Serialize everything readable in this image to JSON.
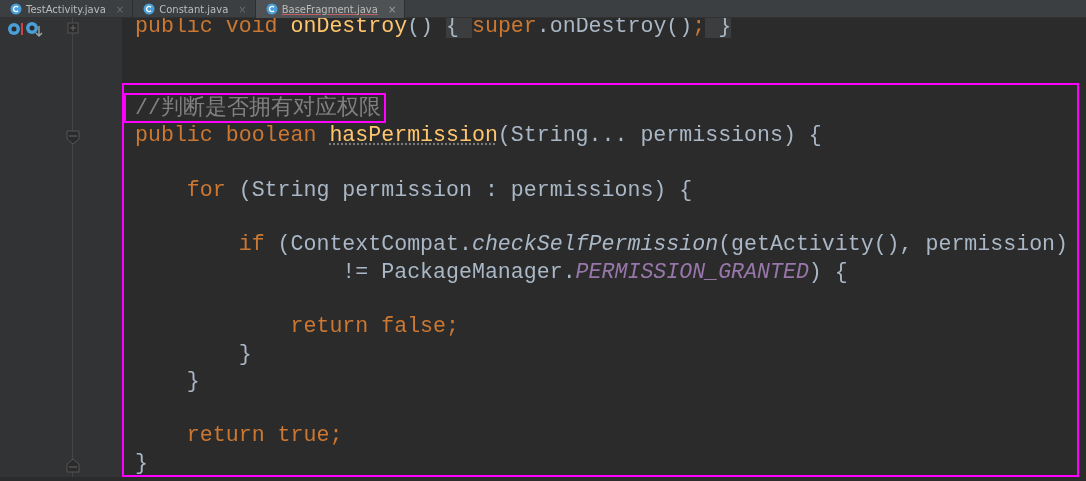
{
  "tabs": [
    {
      "label": "TestActivity.java",
      "selected": false,
      "close": "×"
    },
    {
      "label": "Constant.java",
      "selected": false,
      "close": "×"
    },
    {
      "label": "BaseFragment.java",
      "selected": true,
      "close": "×"
    }
  ],
  "code": {
    "lines": [
      {
        "kind": "code",
        "gutter_marks": true,
        "folded": true,
        "segments": [
          {
            "kind": "keyword",
            "text": "public void "
          },
          {
            "kind": "declaration",
            "text": "onDestroy"
          },
          {
            "kind": "plain",
            "text": "() "
          },
          {
            "kind": "fold",
            "text": "{ "
          },
          {
            "kind": "keyword",
            "text": "super"
          },
          {
            "kind": "plain",
            "text": ".onDestroy()"
          },
          {
            "kind": "keyword",
            "text": ";"
          },
          {
            "kind": "fold",
            "text": " }"
          }
        ]
      },
      {
        "kind": "blank"
      },
      {
        "kind": "blank"
      }
    ],
    "framed_lines": [
      {
        "kind": "code",
        "segments": [
          {
            "kind": "comment",
            "text": "//判断是否拥有对应权限",
            "boxed": true
          }
        ]
      },
      {
        "kind": "code",
        "fold_start": true,
        "segments": [
          {
            "kind": "keyword",
            "text": "public boolean "
          },
          {
            "kind": "declaration",
            "text": "hasPermission",
            "warning": true
          },
          {
            "kind": "plain",
            "text": "(String... permissions) {"
          }
        ]
      },
      {
        "kind": "blank"
      },
      {
        "kind": "code",
        "segments": [
          {
            "kind": "keyword",
            "text": "    for "
          },
          {
            "kind": "plain",
            "text": "(String permission : permissions) {"
          }
        ]
      },
      {
        "kind": "blank"
      },
      {
        "kind": "code",
        "segments": [
          {
            "kind": "keyword",
            "text": "        if "
          },
          {
            "kind": "plain",
            "text": "(ContextCompat."
          },
          {
            "kind": "static",
            "text": "checkSelfPermission"
          },
          {
            "kind": "plain",
            "text": "(getActivity(), permission)"
          }
        ]
      },
      {
        "kind": "code",
        "segments": [
          {
            "kind": "plain",
            "text": "                != PackageManager."
          },
          {
            "kind": "constant",
            "text": "PERMISSION_GRANTED"
          },
          {
            "kind": "plain",
            "text": ") {"
          }
        ]
      },
      {
        "kind": "blank"
      },
      {
        "kind": "code",
        "segments": [
          {
            "kind": "keyword",
            "text": "            return false;"
          }
        ]
      },
      {
        "kind": "code",
        "segments": [
          {
            "kind": "plain",
            "text": "        }"
          }
        ]
      },
      {
        "kind": "code",
        "segments": [
          {
            "kind": "plain",
            "text": "    }"
          }
        ]
      },
      {
        "kind": "blank"
      },
      {
        "kind": "code",
        "segments": [
          {
            "kind": "keyword",
            "text": "    return true;"
          }
        ]
      },
      {
        "kind": "code",
        "fold_end": true,
        "segments": [
          {
            "kind": "plain",
            "text": "}"
          }
        ]
      }
    ]
  }
}
